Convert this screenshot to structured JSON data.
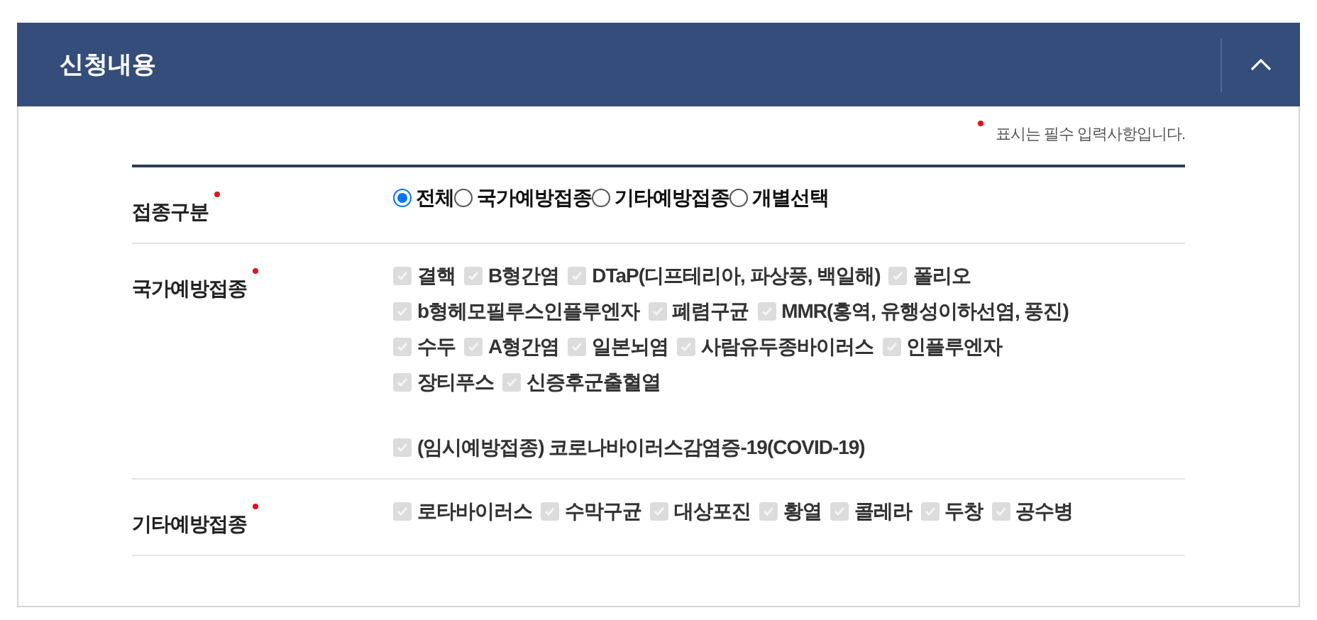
{
  "panel": {
    "title": "신청내용",
    "expanded": true
  },
  "required_note": "표시는 필수 입력사항입니다.",
  "rows": [
    {
      "label": "접종구분",
      "required": true,
      "kind": "radio",
      "options": [
        {
          "label": "전체",
          "selected": true
        },
        {
          "label": "국가예방접종",
          "selected": false
        },
        {
          "label": "기타예방접종",
          "selected": false
        },
        {
          "label": "개별선택",
          "selected": false
        }
      ]
    },
    {
      "label": "국가예방접종",
      "required": true,
      "kind": "checkbox",
      "groups": [
        {
          "lines": [
            [
              {
                "label": "결핵",
                "checked": true,
                "disabled": true
              },
              {
                "label": "B형간염",
                "checked": true,
                "disabled": true
              },
              {
                "label": "DTaP(디프테리아, 파상풍, 백일해)",
                "checked": true,
                "disabled": true
              },
              {
                "label": "폴리오",
                "checked": true,
                "disabled": true
              }
            ],
            [
              {
                "label": "b형헤모필루스인플루엔자",
                "checked": true,
                "disabled": true
              },
              {
                "label": "폐렴구균",
                "checked": true,
                "disabled": true
              },
              {
                "label": "MMR(홍역, 유행성이하선염, 풍진)",
                "checked": true,
                "disabled": true
              }
            ],
            [
              {
                "label": "수두",
                "checked": true,
                "disabled": true
              },
              {
                "label": "A형간염",
                "checked": true,
                "disabled": true
              },
              {
                "label": "일본뇌염",
                "checked": true,
                "disabled": true
              },
              {
                "label": "사람유두종바이러스",
                "checked": true,
                "disabled": true
              },
              {
                "label": "인플루엔자",
                "checked": true,
                "disabled": true
              }
            ],
            [
              {
                "label": "장티푸스",
                "checked": true,
                "disabled": true
              },
              {
                "label": "신증후군출혈열",
                "checked": true,
                "disabled": true
              }
            ]
          ]
        },
        {
          "lines": [
            [
              {
                "label": "(임시예방접종) 코로나바이러스감염증-19(COVID-19)",
                "checked": true,
                "disabled": true
              }
            ]
          ]
        }
      ]
    },
    {
      "label": "기타예방접종",
      "required": true,
      "kind": "checkbox",
      "groups": [
        {
          "lines": [
            [
              {
                "label": "로타바이러스",
                "checked": true,
                "disabled": true
              },
              {
                "label": "수막구균",
                "checked": true,
                "disabled": true
              },
              {
                "label": "대상포진",
                "checked": true,
                "disabled": true
              },
              {
                "label": "황열",
                "checked": true,
                "disabled": true
              },
              {
                "label": "콜레라",
                "checked": true,
                "disabled": true
              },
              {
                "label": "두창",
                "checked": true,
                "disabled": true
              },
              {
                "label": "공수병",
                "checked": true,
                "disabled": true
              }
            ]
          ]
        }
      ]
    }
  ]
}
